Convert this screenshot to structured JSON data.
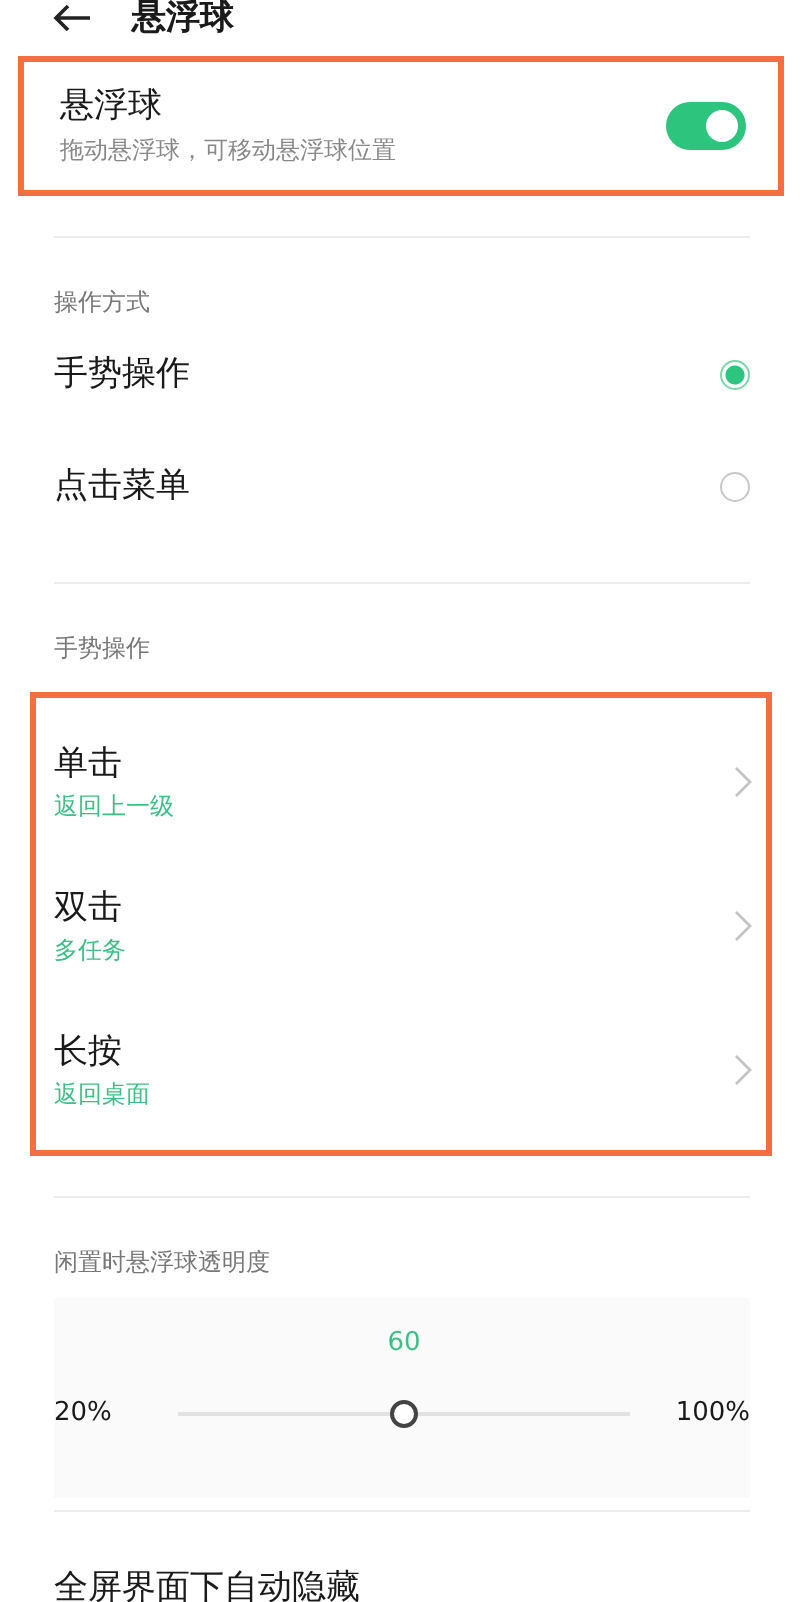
{
  "header": {
    "title": "悬浮球"
  },
  "master": {
    "highlighted": true,
    "title": "悬浮球",
    "subtitle": "拖动悬浮球，可移动悬浮球位置",
    "on": true
  },
  "mode": {
    "heading": "操作方式",
    "options": [
      {
        "label": "手势操作",
        "selected": true
      },
      {
        "label": "点击菜单",
        "selected": false
      }
    ]
  },
  "gestures": {
    "heading": "手势操作",
    "highlighted": true,
    "items": [
      {
        "label": "单击",
        "value": "返回上一级"
      },
      {
        "label": "双击",
        "value": "多任务"
      },
      {
        "label": "长按",
        "value": "返回桌面"
      }
    ]
  },
  "opacity": {
    "heading": "闲置时悬浮球透明度",
    "reading": "60",
    "min_label": "20%",
    "max_label": "100%",
    "level": 0.5
  },
  "auto_hide": {
    "label": "全屏界面下自动隐藏"
  }
}
